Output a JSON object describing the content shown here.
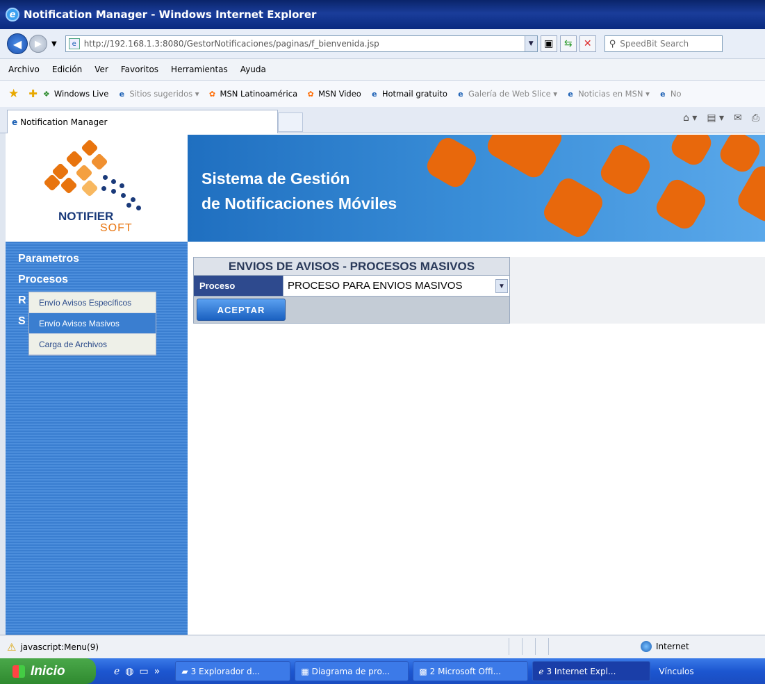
{
  "window": {
    "title": "Notification Manager - Windows Internet Explorer"
  },
  "address": {
    "url": "http://192.168.1.3:8080/GestorNotificaciones/paginas/f_bienvenida.jsp",
    "search_placeholder": "SpeedBit Search"
  },
  "menu": [
    "Archivo",
    "Edición",
    "Ver",
    "Favoritos",
    "Herramientas",
    "Ayuda"
  ],
  "favorites": [
    {
      "label": "Windows Live",
      "icon": "windows-live-icon",
      "dim": false
    },
    {
      "label": "Sitios sugeridos ▾",
      "icon": "ie-icon",
      "dim": true
    },
    {
      "label": "MSN Latinoamérica",
      "icon": "msn-icon",
      "dim": false
    },
    {
      "label": "MSN Video",
      "icon": "msn-icon",
      "dim": false
    },
    {
      "label": "Hotmail gratuito",
      "icon": "ie-icon",
      "dim": false
    },
    {
      "label": "Galería de Web Slice ▾",
      "icon": "ie-icon",
      "dim": true
    },
    {
      "label": "Noticias en MSN ▾",
      "icon": "ie-icon",
      "dim": true
    },
    {
      "label": "No",
      "icon": "ie-icon",
      "dim": true
    }
  ],
  "tab": {
    "label": "Notification Manager"
  },
  "logo": {
    "line1": "NOTIFIER",
    "line2": "SOFT"
  },
  "banner": {
    "line1": "Sistema de Gestión",
    "line2": "de Notificaciones Móviles"
  },
  "sidebar": {
    "links": [
      "Parametros",
      "Procesos",
      "R",
      "S"
    ],
    "submenu": [
      {
        "label": "Envío Avisos Específicos",
        "active": false
      },
      {
        "label": "Envío Avisos Masivos",
        "active": true
      },
      {
        "label": "Carga de Archivos",
        "active": false
      }
    ]
  },
  "form": {
    "title": "ENVIOS DE AVISOS - PROCESOS MASIVOS",
    "field_label": "Proceso",
    "selected_value": "PROCESO PARA ENVIOS MASIVOS",
    "submit_label": "ACEPTAR"
  },
  "status": {
    "text": "javascript:Menu(9)",
    "zone": "Internet"
  },
  "taskbar": {
    "start_label": "Inicio",
    "tasks": [
      {
        "label": "3 Explorador d...",
        "icon": "folder-icon",
        "active": false
      },
      {
        "label": "Diagrama de pro...",
        "icon": "diagram-icon",
        "active": false
      },
      {
        "label": "2 Microsoft Offi...",
        "icon": "office-icon",
        "active": false
      },
      {
        "label": "3 Internet Expl...",
        "icon": "ie-icon",
        "active": true
      }
    ],
    "links_label": "Vínculos"
  }
}
